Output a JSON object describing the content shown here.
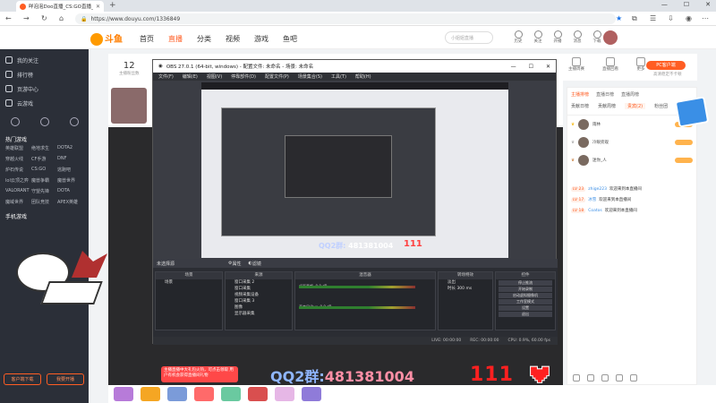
{
  "browser": {
    "tab_title": "咩泡泡Doo直播_CS:GO直播_从0...",
    "url": "https://www.douyu.com/1336849"
  },
  "header": {
    "logo": "斗鱼",
    "menu": [
      "首页",
      "直播",
      "分类",
      "视频",
      "游戏",
      "鱼吧"
    ],
    "search_placeholder": "小姐姐直播",
    "icons": [
      "历史",
      "关注",
      "开播",
      "消息",
      "下载"
    ]
  },
  "sidebar": {
    "items": [
      "我的关注",
      "排行榜",
      "页游中心",
      "云游戏"
    ],
    "section_hot": "热门游戏",
    "games": [
      "英雄联盟",
      "绝地求生",
      "DOTA2",
      "穿越火线",
      "CF手游",
      "DNF",
      "炉石传说",
      "CS:GO",
      "逃跑吧",
      "lol云顶之弈",
      "魔兽争霸",
      "魔兽世界",
      "VALORANT",
      "守望先锋",
      "DOTA",
      "魔域世界",
      "团队竞技",
      "APEX英雄"
    ],
    "section_mobile": "手机游戏",
    "btn_download": "客户端下载",
    "btn_open": "我要开播"
  },
  "room": {
    "viewer_count": "12",
    "viewer_label": "主播粉丝数",
    "right_icons": [
      "主播周赛",
      "直播回看",
      "更多"
    ],
    "pc_button": "PC客户端",
    "pc_sub": "高清稳定不卡顿"
  },
  "obs": {
    "title": "OBS 27.0.1 (64-bit, windows) - 配置文件: 未命名 - 场景: 未命名",
    "menu": [
      "文件(F)",
      "编辑(E)",
      "视图(V)",
      "停靠部件(D)",
      "配置文件(P)",
      "场景集合(S)",
      "工具(T)",
      "帮助(H)"
    ],
    "no_source": "未选择源",
    "props_btn": "属性",
    "filter_btn": "滤镜",
    "docks": {
      "scenes": "场景",
      "sources": "来源",
      "mixer": "混音器",
      "transitions": "转场特效",
      "controls": "控件"
    },
    "scene_items": [
      "场景"
    ],
    "source_items": [
      "窗口采集 2",
      "窗口采集",
      "视频采集设备",
      "窗口采集 3",
      "图像",
      "显示器采集"
    ],
    "mixer_items": [
      "桌面音频",
      "麦克风/Aux"
    ],
    "mixer_levels": [
      "0.0 dB",
      "0.0 dB"
    ],
    "transition_type": "淡出",
    "transition_duration": "300 ms",
    "duration_label": "时长",
    "controls": [
      "停止推流",
      "开始录制",
      "启动虚拟摄像机",
      "工作室模式",
      "设置",
      "退出"
    ],
    "status": [
      "LIVE: 00:00:00",
      "REC: 00:00:00",
      "CPU: 0.9%, 60.00 fps"
    ],
    "overlay_qq": "QQ2群:",
    "overlay_qq_num": "481381004",
    "overlay_num": "111"
  },
  "overlay": {
    "banner": "主播直播中大礼包火热，可点击领取 用户有机会获得直播间礼物",
    "qq_label": "QQ2群:",
    "qq_num": "481381004",
    "big_num": "111"
  },
  "chat": {
    "tabs": [
      "主播排榜",
      "直播日榜",
      "直播周榜"
    ],
    "sub_tabs": [
      "贡献日榜",
      "贡献周榜",
      "贵宾(2)",
      "粉丝团"
    ],
    "ranks": [
      "雨林",
      "冷眼旁观",
      "迷你_人"
    ],
    "messages": [
      {
        "lv": "LV 23",
        "user": "zhige223",
        "text": "欢迎来到本直播间"
      },
      {
        "lv": "LV 17",
        "user": "冰雪",
        "text": "欢迎来到本直播间"
      },
      {
        "lv": "LV 18",
        "user": "Coatos",
        "text": "欢迎来到本直播间"
      }
    ]
  },
  "colors": {
    "brand": "#ff5d23",
    "sidebar_bg": "#2b2f38",
    "obs_bg": "#3b3d44"
  }
}
